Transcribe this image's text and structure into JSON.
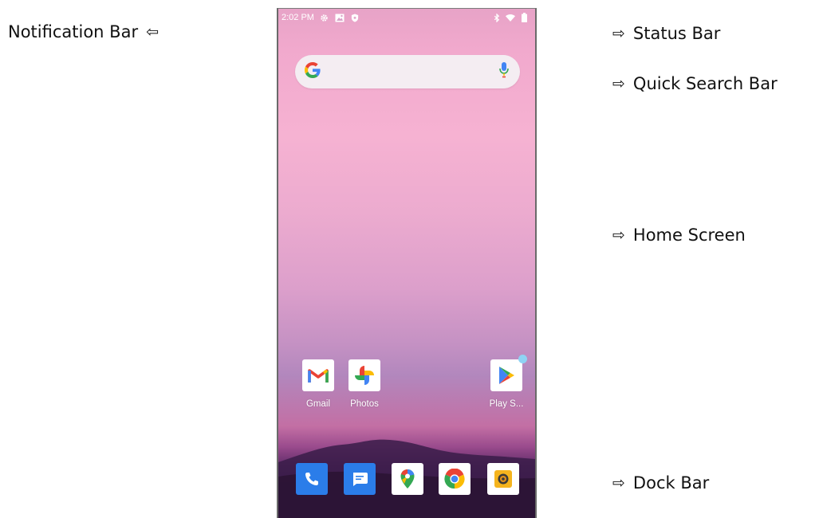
{
  "annotations": {
    "notification_bar": "Notification Bar",
    "status_bar": "Status Bar",
    "quick_search_bar": "Quick Search Bar",
    "home_screen": "Home Screen",
    "dock_bar": "Dock Bar",
    "arrow_left": "⇦",
    "arrow_right": "⇨"
  },
  "status_bar": {
    "time": "2:02 PM",
    "left_icons": [
      "gear-icon",
      "image-notification-icon",
      "shield-icon"
    ],
    "right_icons": [
      "bluetooth-icon",
      "wifi-icon",
      "battery-icon"
    ]
  },
  "search_bar": {
    "logo": "G",
    "icons": [
      "google-logo-icon",
      "microphone-icon"
    ]
  },
  "home_apps": [
    {
      "label": "Gmail",
      "icon": "gmail-icon"
    },
    {
      "label": "Photos",
      "icon": "photos-icon"
    },
    {
      "label": "Play S...",
      "icon": "play-store-icon",
      "badge": true
    }
  ],
  "dock_apps": [
    {
      "icon": "phone-icon"
    },
    {
      "icon": "messages-icon"
    },
    {
      "icon": "maps-icon"
    },
    {
      "icon": "chrome-icon"
    },
    {
      "icon": "camera-icon"
    }
  ],
  "colors": {
    "google_blue": "#4285F4",
    "google_red": "#EA4335",
    "google_yellow": "#FBBC05",
    "google_green": "#34A853",
    "dock_blue": "#2b7de9",
    "badge": "#8fd3f4"
  }
}
